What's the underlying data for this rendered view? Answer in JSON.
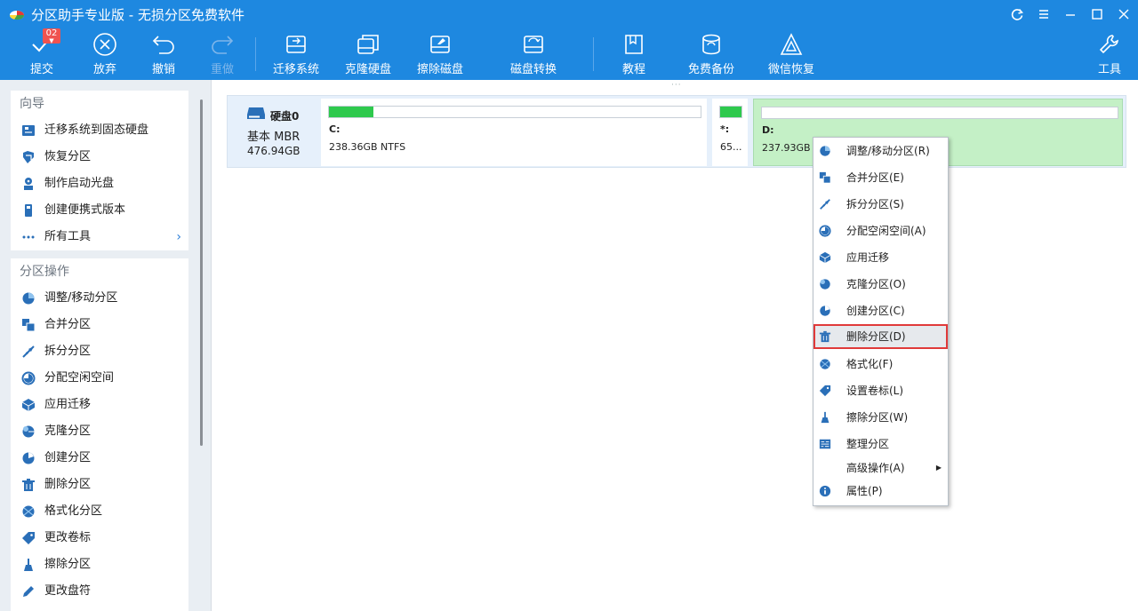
{
  "window": {
    "title": "分区助手专业版 - 无损分区免费软件"
  },
  "toolbar": {
    "commit": {
      "label": "提交",
      "badge": "02"
    },
    "discard": {
      "label": "放弃"
    },
    "undo": {
      "label": "撤销"
    },
    "redo": {
      "label": "重做"
    },
    "migrate_os": {
      "label": "迁移系统"
    },
    "clone_disk": {
      "label": "克隆硬盘"
    },
    "wipe_disk": {
      "label": "擦除磁盘"
    },
    "disk_convert": {
      "label": "磁盘转换"
    },
    "tutorial": {
      "label": "教程"
    },
    "free_backup": {
      "label": "免费备份"
    },
    "wechat_recovery": {
      "label": "微信恢复"
    },
    "tools": {
      "label": "工具"
    }
  },
  "sidebar": {
    "wizard": {
      "title": "向导",
      "items": [
        {
          "label": "迁移系统到固态硬盘",
          "icon": "migrate-icon"
        },
        {
          "label": "恢复分区",
          "icon": "recover-icon"
        },
        {
          "label": "制作启动光盘",
          "icon": "boot-disc-icon"
        },
        {
          "label": "创建便携式版本",
          "icon": "portable-icon"
        },
        {
          "label": "所有工具",
          "icon": "more-icon"
        }
      ]
    },
    "partition_ops": {
      "title": "分区操作",
      "items": [
        {
          "label": "调整/移动分区",
          "icon": "resize-icon"
        },
        {
          "label": "合并分区",
          "icon": "merge-icon"
        },
        {
          "label": "拆分分区",
          "icon": "split-icon"
        },
        {
          "label": "分配空闲空间",
          "icon": "allocate-icon"
        },
        {
          "label": "应用迁移",
          "icon": "app-move-icon"
        },
        {
          "label": "克隆分区",
          "icon": "clone-icon"
        },
        {
          "label": "创建分区",
          "icon": "create-icon"
        },
        {
          "label": "删除分区",
          "icon": "delete-icon"
        },
        {
          "label": "格式化分区",
          "icon": "format-icon"
        },
        {
          "label": "更改卷标",
          "icon": "label-icon"
        },
        {
          "label": "擦除分区",
          "icon": "wipe-icon"
        },
        {
          "label": "更改盘符",
          "icon": "letter-icon"
        }
      ]
    }
  },
  "disk": {
    "name": "硬盘0",
    "type": "基本 MBR",
    "size": "476.94GB",
    "partitions": [
      {
        "label": "C:",
        "info": "238.36GB NTFS",
        "used_fraction": 0.12
      },
      {
        "label": "*:",
        "info": "65...",
        "used_fraction": 1.0
      },
      {
        "label": "D:",
        "info": "237.93GB N",
        "used_fraction": 0.0
      }
    ]
  },
  "context_menu": {
    "items": [
      {
        "label": "调整/移动分区(R)",
        "icon": "resize-icon"
      },
      {
        "label": "合并分区(E)",
        "icon": "merge-icon"
      },
      {
        "label": "拆分分区(S)",
        "icon": "split-icon"
      },
      {
        "label": "分配空闲空间(A)",
        "icon": "allocate-icon"
      },
      {
        "label": "应用迁移",
        "icon": "app-move-icon"
      },
      {
        "label": "克隆分区(O)",
        "icon": "clone-icon"
      },
      {
        "label": "创建分区(C)",
        "icon": "create-icon"
      },
      {
        "label": "删除分区(D)",
        "icon": "delete-icon"
      },
      {
        "label": "格式化(F)",
        "icon": "format-icon"
      },
      {
        "label": "设置卷标(L)",
        "icon": "label-icon"
      },
      {
        "label": "擦除分区(W)",
        "icon": "wipe-icon"
      },
      {
        "label": "整理分区",
        "icon": "defrag-icon"
      },
      {
        "label": "高级操作(A)",
        "icon": ""
      },
      {
        "label": "属性(P)",
        "icon": "info-icon"
      }
    ]
  },
  "colors": {
    "toolbar_bg": "#1e88e0",
    "accent_blue": "#2d7fd8",
    "used_green": "#2ec94d",
    "selected_partition": "#c4f0c6",
    "highlight_border": "#e03a3a"
  }
}
